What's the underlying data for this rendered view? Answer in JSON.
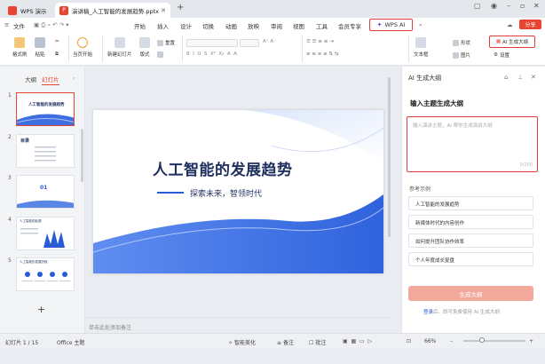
{
  "titlebar": {
    "app_tab": "WPS 演示",
    "doc_tab": "演讲稿_人工智能的发展趋势.pptx"
  },
  "menu": {
    "file": "文件",
    "items": [
      "开始",
      "插入",
      "设计",
      "切换",
      "动画",
      "放映",
      "审阅",
      "视图",
      "工具",
      "会员专享"
    ],
    "wps_ai": "WPS AI",
    "share": "分享"
  },
  "ribbon": {
    "format_painter": "格式刷",
    "paste": "粘贴",
    "from_current": "当页开始",
    "new_slide": "新建幻灯片",
    "layout": "版式",
    "reset": "重置",
    "textbox": "文本框",
    "shape": "形状",
    "picture": "图片",
    "ai_outline": "AI 生成大纲",
    "settings": "设置"
  },
  "leftpanel": {
    "tab_outline": "大纲",
    "tab_slides": "幻灯片",
    "thumbs": [
      {
        "num": "1",
        "title": "人工智能的发展趋势"
      },
      {
        "num": "2",
        "title": "目录"
      },
      {
        "num": "3",
        "title": "01"
      },
      {
        "num": "4",
        "title": "人工智能的起源"
      },
      {
        "num": "5",
        "title": "人工智能的发展历程"
      }
    ],
    "add": "+"
  },
  "slide": {
    "title": "人工智能的发展趋势",
    "subtitle": "探索未来，智领时代"
  },
  "notes_placeholder": "单击此处添加备注",
  "aipanel": {
    "title": "AI 生成大纲",
    "heading": "输入主题生成大纲",
    "input_placeholder": "输入演讲主题，AI 帮你生成演讲大纲",
    "counter": "0/200",
    "examples_title": "参考示例",
    "examples": [
      "人工智能的发展趋势",
      "新媒体时代的内容创作",
      "如何提升团队协作效率",
      "个人年度成长复盘"
    ],
    "generate": "生成大纲",
    "login_link": "登录",
    "login_tip": "后，即可免费使用 AI 生成大纲"
  },
  "statusbar": {
    "slide_info": "幻灯片 1 / 15",
    "theme": "Office 主题",
    "smart_beautify": "智能美化",
    "notes": "备注",
    "comments": "批注",
    "zoom": "66%"
  },
  "colors": {
    "accent": "#e8442f",
    "highlight_border": "#e23b3b",
    "slide_title": "#1e2f5e",
    "slide_blue": "#2a5bd7"
  }
}
